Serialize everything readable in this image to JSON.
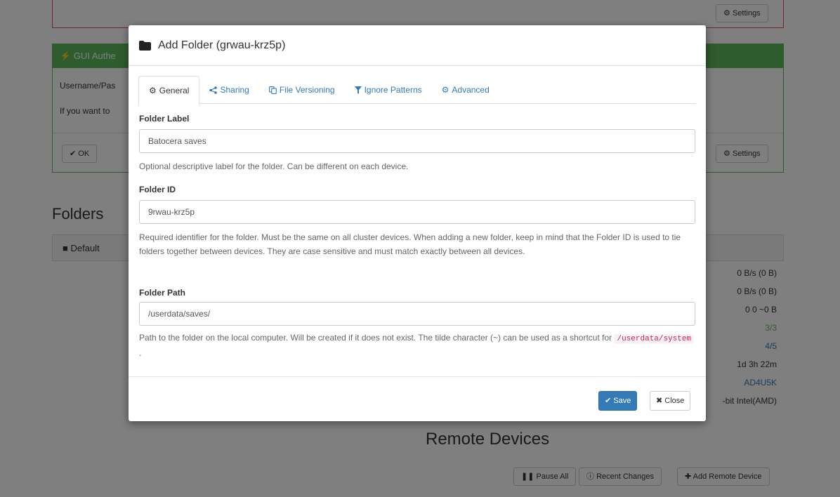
{
  "background": {
    "settings_top_label": "Settings",
    "gui_auth_header": "GUI Authe",
    "gui_auth_line1": "Username/Pas",
    "gui_auth_line2": "If you want to",
    "ok_label": "OK",
    "settings_bottom_label": "Settings",
    "folders_title": "Folders",
    "default_folder": "Default",
    "stats": [
      "0 B/s (0 B)",
      "0 B/s (0 B)",
      "0 0 ~0 B",
      "3/3",
      "4/5",
      "1d 3h 22m",
      "AD4U5K",
      "-bit Intel(AMD)"
    ],
    "remote_devices_title": "Remote Devices",
    "pause_all_label": "Pause All",
    "recent_changes_label": "Recent Changes",
    "add_remote_device_label": "Add Remote Device"
  },
  "modal": {
    "title": "Add Folder (grwau-krz5p)",
    "tabs": [
      {
        "label": "General",
        "icon": "gear-icon"
      },
      {
        "label": "Sharing",
        "icon": "share-icon"
      },
      {
        "label": "File Versioning",
        "icon": "copy-icon"
      },
      {
        "label": "Ignore Patterns",
        "icon": "filter-icon"
      },
      {
        "label": "Advanced",
        "icon": "gears-icon"
      }
    ],
    "folder_label": {
      "label": "Folder Label",
      "value": "Batocera saves",
      "help": "Optional descriptive label for the folder. Can be different on each device."
    },
    "folder_id": {
      "label": "Folder ID",
      "value": "9rwau-krz5p",
      "help": "Required identifier for the folder. Must be the same on all cluster devices. When adding a new folder, keep in mind that the Folder ID is used to tie folders together between devices. They are case sensitive and must match exactly between all devices."
    },
    "folder_path": {
      "label": "Folder Path",
      "value": "/userdata/saves/",
      "help_pre": "Path to the folder on the local computer. Will be created if it does not exist. The tilde character (~) can be used as a shortcut for",
      "help_code": "/userdata/system",
      "help_post": "."
    },
    "save_label": "Save",
    "close_label": "Close"
  },
  "colors": {
    "primary": "#337ab7",
    "success": "#5cb85c",
    "danger": "#d9534f"
  }
}
